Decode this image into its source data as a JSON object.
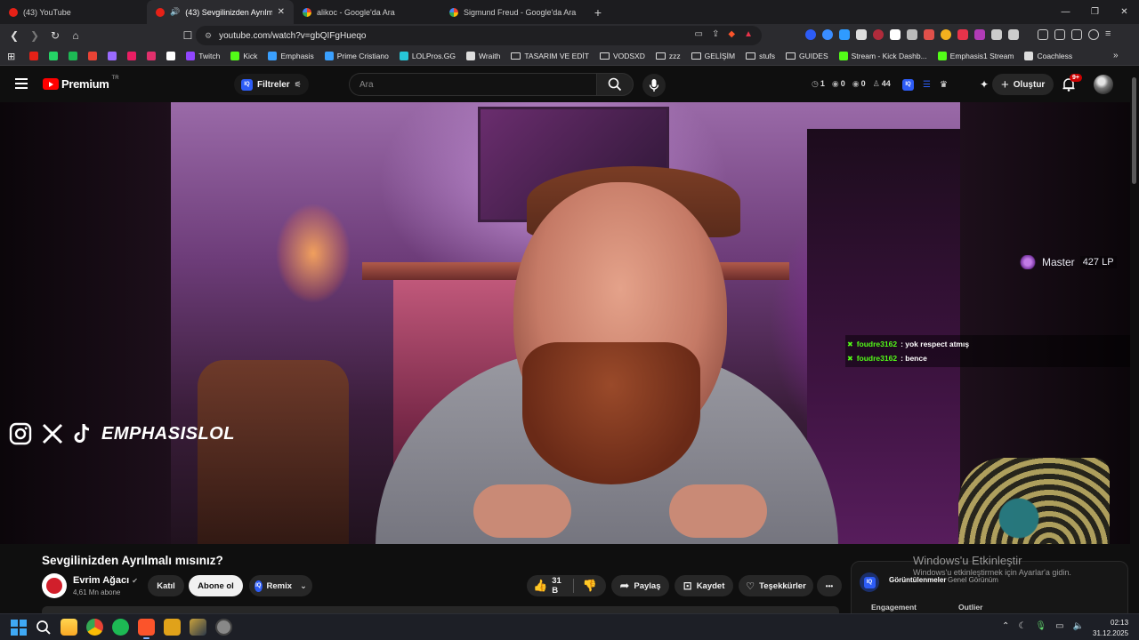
{
  "tabs": [
    {
      "label": "(43) YouTube",
      "favicon": "youtube-icon",
      "active": false
    },
    {
      "label": "(43) Sevgilinizden Ayrılmalı m",
      "favicon": "youtube-icon",
      "active": true,
      "audio": "speaker-icon"
    },
    {
      "label": "alikoc - Google'da Ara",
      "favicon": "google-icon",
      "active": false
    },
    {
      "label": "Sigmund Freud - Google'da Ara",
      "favicon": "google-icon",
      "active": false
    }
  ],
  "address": {
    "url": "youtube.com/watch?v=gbQIFgHueqo"
  },
  "bookmarks": [
    {
      "label": "",
      "icon": "youtube-bm-icon",
      "color": "#e62117"
    },
    {
      "label": "",
      "icon": "whatsapp-bm-icon",
      "color": "#25d366"
    },
    {
      "label": "",
      "icon": "green-bm-icon",
      "color": "#1db954"
    },
    {
      "label": "",
      "icon": "gmail-bm-icon",
      "color": "#ea4335"
    },
    {
      "label": "",
      "icon": "feather-bm-icon",
      "color": "#9a6bff"
    },
    {
      "label": "",
      "icon": "red-circle-bm-icon",
      "color": "#e91e63"
    },
    {
      "label": "",
      "icon": "instagram-bm-icon",
      "color": "#e1306c"
    },
    {
      "label": "",
      "icon": "tiktok-bm-icon",
      "color": "#ffffff"
    },
    {
      "label": "Twitch",
      "icon": "twitch-icon",
      "color": "#9146ff"
    },
    {
      "label": "Kick",
      "icon": "kick-icon",
      "color": "#53fc18"
    },
    {
      "label": "Emphasis",
      "icon": "d-icon",
      "color": "#3aa0ff"
    },
    {
      "label": "Prime Cristiano",
      "icon": "d-icon",
      "color": "#3aa0ff"
    },
    {
      "label": "LOLPros.GG",
      "icon": "lolpros-icon",
      "color": "#27c6d9"
    },
    {
      "label": "Wraith",
      "icon": "wraith-icon",
      "color": "#dddddd"
    },
    {
      "label": "TASARIM VE EDİT",
      "icon": "folder-icon",
      "color": ""
    },
    {
      "label": "VODSXD",
      "icon": "folder-icon",
      "color": ""
    },
    {
      "label": "zzz",
      "icon": "folder-icon",
      "color": ""
    },
    {
      "label": "GELİŞİM",
      "icon": "folder-icon",
      "color": ""
    },
    {
      "label": "stufs",
      "icon": "folder-icon",
      "color": ""
    },
    {
      "label": "GUIDES",
      "icon": "folder-icon",
      "color": ""
    },
    {
      "label": "Stream - Kick Dashb...",
      "icon": "kick-icon",
      "color": "#53fc18"
    },
    {
      "label": "Emphasis1 Stream",
      "icon": "kick-icon",
      "color": "#53fc18"
    },
    {
      "label": "Coachless",
      "icon": "coachless-icon",
      "color": "#dddddd"
    }
  ],
  "yt_header": {
    "logo_text": "Premium",
    "logo_sup": "TR",
    "filter_label": "Filtreler",
    "search_placeholder": "Ara",
    "stats": [
      {
        "icon": "clock-icon",
        "value": "1"
      },
      {
        "icon": "eye-icon",
        "value": "0"
      },
      {
        "icon": "eye-icon",
        "value": "0"
      },
      {
        "icon": "person-icon",
        "value": "44"
      }
    ],
    "create_label": "Oluştur",
    "notif_badge": "9+"
  },
  "overlay": {
    "brand": "EMPHASISLOL",
    "rank": "Master",
    "lp": "427 LP",
    "chat": [
      {
        "user": "foudre3162",
        "text": ": yok respect atmış"
      },
      {
        "user": "foudre3162",
        "text": ": bence"
      }
    ],
    "windows_activation": {
      "title": "Windows'u Etkinleştir",
      "subtitle": "Windows'u etkinleştirmek için Ayarlar'a gidin."
    }
  },
  "video": {
    "title": "Sevgilinizden Ayrılmalı mısınız?",
    "channel": "Evrim Ağacı",
    "subscribers": "4,61 Mn abone",
    "join_label": "Katıl",
    "subscribe_label": "Abone ol",
    "remix_label": "Remix",
    "likes": "31 B",
    "share_label": "Paylaş",
    "save_label": "Kaydet",
    "thanks_label": "Teşekkürler",
    "more_label": "•••"
  },
  "side_panel": {
    "tab_active": "Görüntülenmeler",
    "tab_other": "Genel Görünüm",
    "col1": "Engagement",
    "col2": "Outlier"
  },
  "taskbar": {
    "time": "02:13",
    "date": "31.12.2025"
  },
  "colors": {
    "accent": "#ff0000",
    "kick": "#53fc18",
    "iq": "#2d5cf6"
  }
}
